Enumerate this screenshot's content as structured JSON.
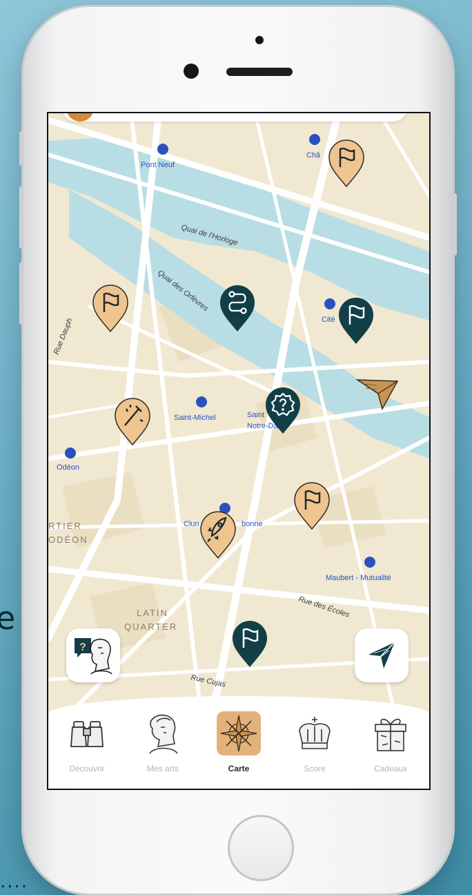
{
  "background_text": {
    "letter": "e",
    "dots": "...."
  },
  "map": {
    "labels": {
      "pont_neuf": "Pont Neuf",
      "chatelet": "Châ",
      "quai_horloge": "Quai de l'Horloge",
      "quai_orfevres": "Quai des Orfèvres",
      "rue_dauphine": "Rue Dauph",
      "cite": "Cité",
      "saint_michel": "Saint-Michel",
      "saint_notre_dame_1": "Saint",
      "saint_notre_dame_2": "Notre-Dame",
      "odeon": "Odéon",
      "quartier_odeon_1": "RTIER",
      "quartier_odeon_2": "ODÉON",
      "cluny_1": "Clun",
      "cluny_2": "bonne",
      "maubert": "Maubert - Mutualité",
      "rue_ecoles": "Rue des Écoles",
      "latin_1": "LATIN",
      "latin_2": "QUARTER",
      "rue_cujas": "Rue Cujas"
    },
    "pins": [
      {
        "icon": "flag-icon",
        "style": "light"
      },
      {
        "icon": "flag-icon",
        "style": "light"
      },
      {
        "icon": "route-icon",
        "style": "dark"
      },
      {
        "icon": "flag-icon",
        "style": "dark"
      },
      {
        "icon": "magic-wand-icon",
        "style": "light"
      },
      {
        "icon": "question-badge-icon",
        "style": "dark"
      },
      {
        "icon": "flag-icon",
        "style": "light"
      },
      {
        "icon": "rocket-icon",
        "style": "light"
      },
      {
        "icon": "flag-icon",
        "style": "dark"
      }
    ],
    "user_location_icon": "paper-plane-icon"
  },
  "colors": {
    "pin_light": "#efc48e",
    "pin_dark": "#123e48",
    "water": "#b9dde4",
    "land": "#f1e8d2",
    "road": "#ffffff",
    "accent": "#e2b27c"
  },
  "floating_buttons": {
    "help": "help-bust-icon",
    "locate": "navigate-arrow-icon"
  },
  "nav": [
    {
      "label": "Découvrir",
      "icon": "binoculars-icon",
      "active": false
    },
    {
      "label": "Mes arts",
      "icon": "bust-icon",
      "active": false
    },
    {
      "label": "Carte",
      "icon": "compass-rose-icon",
      "active": true
    },
    {
      "label": "Score",
      "icon": "crown-icon",
      "active": false
    },
    {
      "label": "Cadeaux",
      "icon": "gift-icon",
      "active": false
    }
  ]
}
